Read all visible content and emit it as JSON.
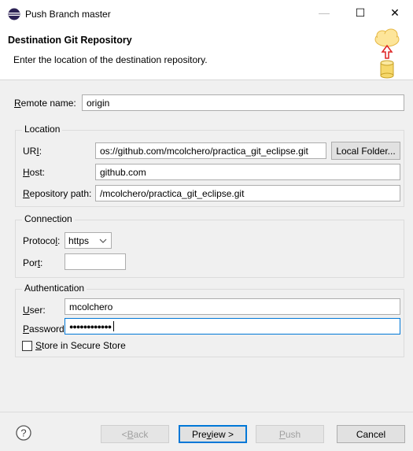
{
  "window": {
    "title": "Push Branch master",
    "min_icon": "minimize-icon",
    "max_icon": "maximize-icon",
    "close_icon": "close-icon",
    "min_glyph": "—",
    "max_glyph": "☐",
    "close_glyph": "✕"
  },
  "header": {
    "title": "Destination Git Repository",
    "description": "Enter the location of the destination repository."
  },
  "remote": {
    "label_u": "R",
    "label_rest": "emote name:",
    "value": "origin"
  },
  "location": {
    "group_title": "Location",
    "uri_label_pre": "UR",
    "uri_label_u": "I",
    "uri_label_post": ":",
    "uri_value": "os://github.com/mcolchero/practica_git_eclipse.git",
    "local_folder_button": "Local Folder...",
    "host_label_u": "H",
    "host_label_rest": "ost:",
    "host_value": "github.com",
    "repo_label_u": "R",
    "repo_label_rest": "epository path:",
    "repo_value": "/mcolchero/practica_git_eclipse.git"
  },
  "connection": {
    "group_title": "Connection",
    "protocol_label_pre": "Protoco",
    "protocol_label_u": "l",
    "protocol_label_post": ":",
    "protocol_value": "https",
    "port_label_pre": "Por",
    "port_label_u": "t",
    "port_label_post": ":",
    "port_value": ""
  },
  "authentication": {
    "group_title": "Authentication",
    "user_label_u": "U",
    "user_label_rest": "ser:",
    "user_value": "mcolchero",
    "password_label_u": "P",
    "password_label_rest": "assword:",
    "password_value": "●●●●●●●●●●●●",
    "store_u": "S",
    "store_rest": "tore in Secure Store",
    "store_checked": false
  },
  "footer": {
    "help_glyph": "?",
    "back_pre": "< ",
    "back_u": "B",
    "back_post": "ack",
    "preview_pre": "Pre",
    "preview_u": "v",
    "preview_post": "iew >",
    "push_u": "P",
    "push_post": "ush",
    "cancel": "Cancel"
  },
  "colors": {
    "accent": "#0078d7",
    "header_bg": "#ffffff",
    "dialog_bg": "#f0f0f0"
  }
}
